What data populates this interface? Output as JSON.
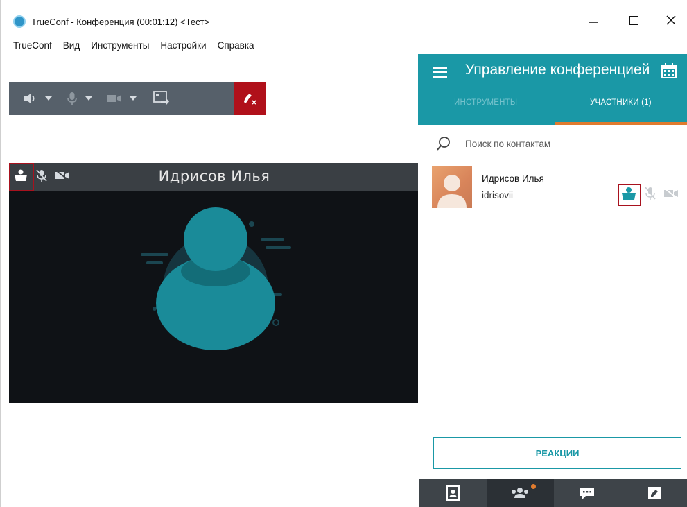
{
  "window": {
    "title": "TrueConf - Конференция (00:01:12) <Тест>",
    "controls": [
      "minimize",
      "maximize",
      "close"
    ]
  },
  "menu": {
    "items": [
      "TrueConf",
      "Вид",
      "Инструменты",
      "Настройки",
      "Справка"
    ]
  },
  "toolbar": {
    "buttons": [
      "speaker-icon",
      "microphone-icon",
      "camera-icon",
      "share-screen-icon",
      "hangup-icon"
    ],
    "colors": {
      "bar": "#56606a",
      "hangup": "#b0101a"
    }
  },
  "video": {
    "participant_name": "Идрисов Илья",
    "status_icons": [
      "presenter-icon",
      "microphone-muted-icon",
      "camera-off-icon"
    ]
  },
  "panel": {
    "title": "Управление конференцией",
    "tabs": [
      {
        "label": "ИНСТРУМЕНТЫ",
        "active": false
      },
      {
        "label": "УЧАСТНИКИ (1)",
        "active": true
      }
    ],
    "search_placeholder": "Поиск по контактам",
    "participants": [
      {
        "name": "Идрисов Илья",
        "login": "idrisovii",
        "icons": [
          "presenter-icon",
          "microphone-muted-icon",
          "camera-off-icon"
        ]
      }
    ],
    "reactions_label": "РЕАКЦИИ",
    "bottom_nav": [
      "address-book-icon",
      "participants-icon",
      "chat-icon",
      "edit-icon"
    ],
    "colors": {
      "header": "#1a98a6",
      "tab_underline": "#e07b2e",
      "bottom_bar": "#3e4449"
    }
  }
}
